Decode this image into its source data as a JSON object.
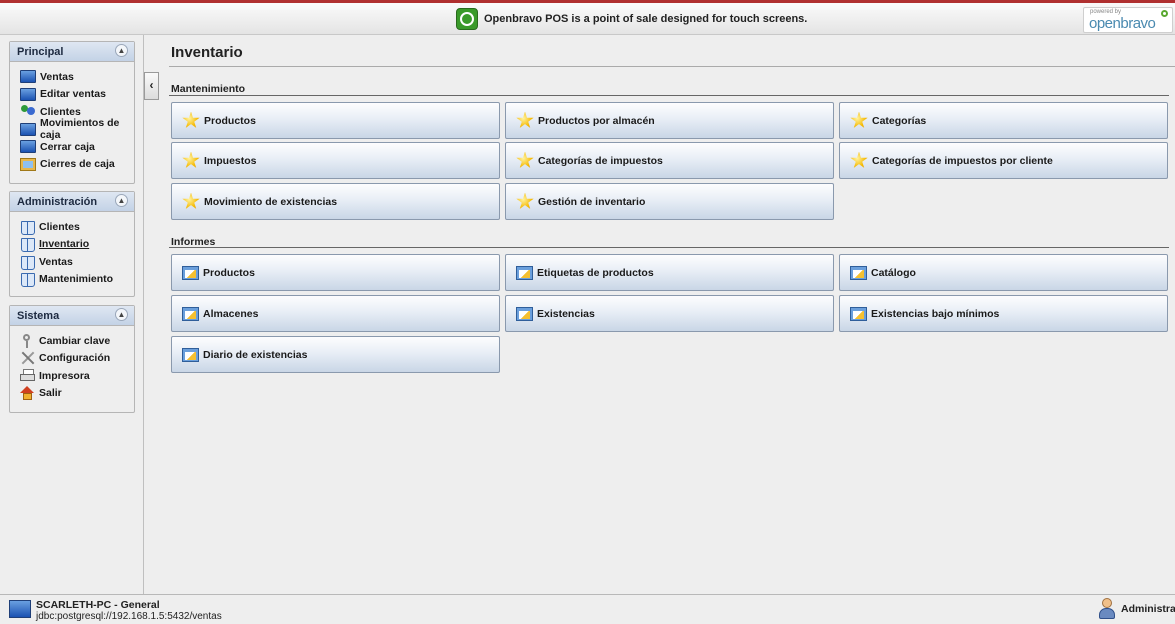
{
  "banner": {
    "text": "Openbravo POS is a point of sale designed for touch screens.",
    "powered_by": "powered by",
    "brand": "openbravo"
  },
  "sidebar": {
    "groups": [
      {
        "title": "Principal",
        "items": [
          {
            "label": "Ventas",
            "icon": "monitor-icon"
          },
          {
            "label": "Editar ventas",
            "icon": "monitor-icon"
          },
          {
            "label": "Clientes",
            "icon": "people-icon"
          },
          {
            "label": "Movimientos de caja",
            "icon": "monitor-icon"
          },
          {
            "label": "Cerrar caja",
            "icon": "monitor-icon"
          },
          {
            "label": "Cierres de caja",
            "icon": "calculator-icon"
          }
        ]
      },
      {
        "title": "Administración",
        "items": [
          {
            "label": "Clientes",
            "icon": "book-icon"
          },
          {
            "label": "Inventario",
            "icon": "book-icon",
            "selected": true
          },
          {
            "label": "Ventas",
            "icon": "book-icon"
          },
          {
            "label": "Mantenimiento",
            "icon": "book-icon"
          }
        ]
      },
      {
        "title": "Sistema",
        "items": [
          {
            "label": "Cambiar clave",
            "icon": "key-icon"
          },
          {
            "label": "Configuración",
            "icon": "tools-icon"
          },
          {
            "label": "Impresora",
            "icon": "printer-icon"
          },
          {
            "label": "Salir",
            "icon": "home-icon"
          }
        ]
      }
    ]
  },
  "main": {
    "title": "Inventario",
    "sections": [
      {
        "label": "Mantenimiento",
        "buttons": [
          "Productos",
          "Productos por almacén",
          "Categorías",
          "Impuestos",
          "Categorías de impuestos",
          "Categorías de impuestos por cliente",
          "Movimiento de existencias",
          "Gestión de inventario"
        ]
      },
      {
        "label": "Informes",
        "buttons": [
          "Productos",
          "Etiquetas de productos",
          "Catálogo",
          "Almacenes",
          "Existencias",
          "Existencias bajo mínimos",
          "Diario de existencias"
        ]
      }
    ]
  },
  "status": {
    "host": "SCARLETH-PC - General",
    "db": "jdbc:postgresql://192.168.1.5:5432/ventas",
    "user": "Administrator"
  },
  "colors": {
    "accent": "#b03030",
    "button_border": "#8a99ad",
    "panel_header": "#c3d2e6"
  }
}
